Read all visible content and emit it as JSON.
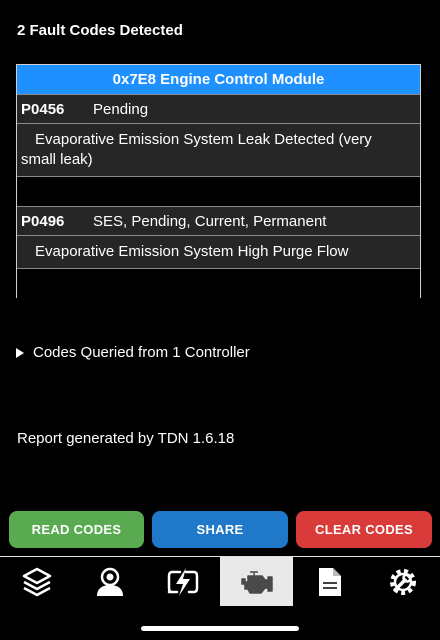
{
  "title": "2 Fault Codes Detected",
  "module": {
    "header": "0x7E8 Engine Control Module",
    "faults": [
      {
        "code": "P0456",
        "status": "Pending",
        "description": "Evaporative Emission System Leak Detected (very small leak)"
      },
      {
        "code": "P0496",
        "status": "SES, Pending, Current, Permanent",
        "description": "Evaporative Emission System High Purge Flow"
      }
    ]
  },
  "summary": "Codes Queried from 1 Controller",
  "report": "Report generated by TDN 1.6.18",
  "buttons": {
    "read": "READ CODES",
    "share": "SHARE",
    "clear": "CLEAR CODES"
  },
  "colors": {
    "header_blue": "#1e90ff",
    "read_green": "#5aaa52",
    "share_blue": "#1f78c8",
    "clear_red": "#d93a3a"
  },
  "tabs": [
    {
      "icon": "layers-icon"
    },
    {
      "icon": "person-icon"
    },
    {
      "icon": "bolt-icon"
    },
    {
      "icon": "engine-icon",
      "active": true
    },
    {
      "icon": "document-icon"
    },
    {
      "icon": "gear-wrench-icon"
    }
  ]
}
